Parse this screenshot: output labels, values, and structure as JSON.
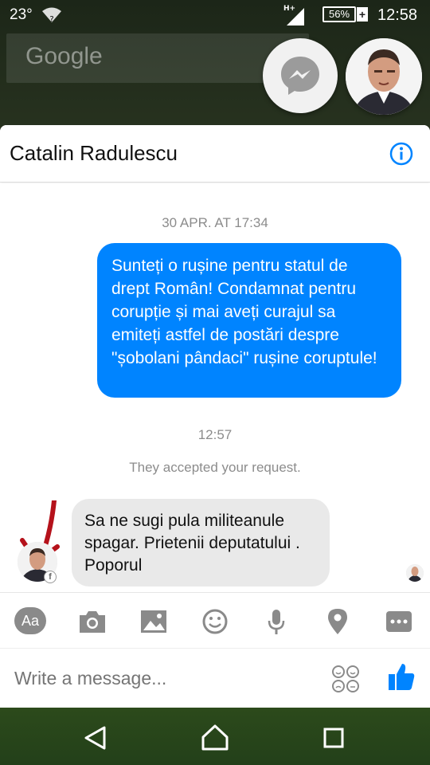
{
  "status_bar": {
    "temperature": "23°",
    "network": "H+",
    "battery": "56%",
    "battery_plus": "+",
    "time": "12:58"
  },
  "google_widget": {
    "label": "Google"
  },
  "chat": {
    "contact_name": "Catalin Radulescu",
    "timestamp_1": "30 APR. AT 17:34",
    "outgoing_message": "Sunteți o rușine pentru statul de drept Român! Condamnat pentru corupție și mai aveți curajul sa emiteți astfel de postări despre \"șobolani pândaci\"  rușine coruptule!",
    "timestamp_2": "12:57",
    "system_note": "They accepted your request.",
    "incoming_message": "Sa ne sugi pula militeanule spagar. Prietenii deputatului . Poporul"
  },
  "composer": {
    "aa_label": "Aa",
    "input_placeholder": "Write a message..."
  },
  "colors": {
    "outgoing_bubble": "#0084ff",
    "incoming_bubble": "#e9e9e9",
    "accent": "#0084ff"
  }
}
